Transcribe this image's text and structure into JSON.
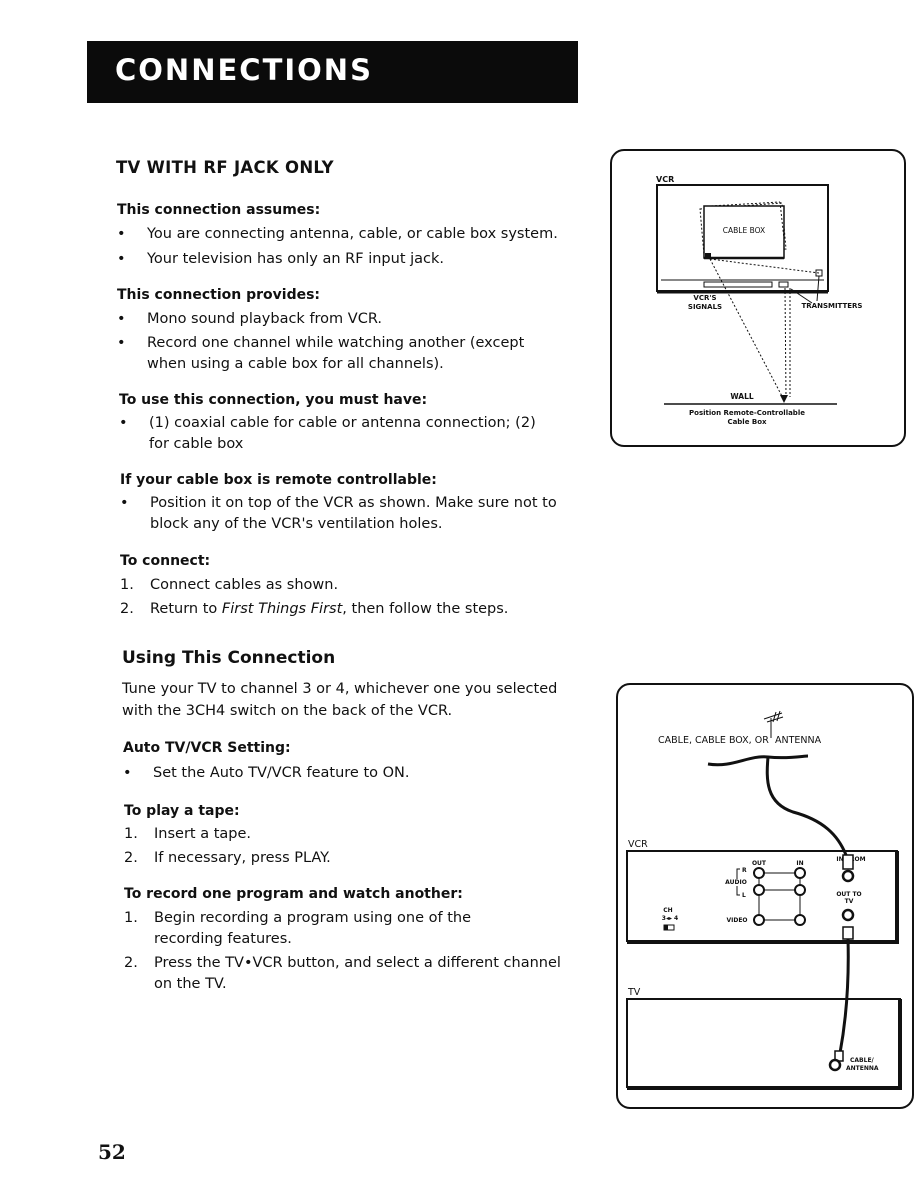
{
  "header": {
    "title": "CONNECTIONS"
  },
  "section": {
    "title": "TV WITH RF JACK ONLY",
    "assumes": {
      "heading": "This connection assumes:",
      "items": [
        "You are connecting antenna, cable, or cable box system.",
        "Your television has only an RF input jack."
      ]
    },
    "provides": {
      "heading": "This connection provides:",
      "items": [
        "Mono sound playback from VCR.",
        "Record one channel while watching another (except when using a cable box for all channels)."
      ]
    },
    "must_have": {
      "heading": "To use this connection, you must have:",
      "items": [
        "(1) coaxial cable for cable or antenna connection; (2) for cable box"
      ]
    },
    "remote": {
      "heading": "If your cable box is remote controllable:",
      "items": [
        "Position it on top of the VCR as shown. Make sure not to block any of the VCR's ventilation holes."
      ]
    },
    "connect": {
      "heading": "To connect:",
      "steps": [
        {
          "num": "1.",
          "text": "Connect cables as shown."
        },
        {
          "num": "2.",
          "pre": "Return to ",
          "italic": "First Things First",
          "post": ", then follow the steps."
        }
      ]
    }
  },
  "using": {
    "title": "Using This Connection",
    "intro": "Tune your TV to channel 3 or 4, whichever one you selected with the 3CH4 switch on the back of the VCR.",
    "auto": {
      "heading": "Auto TV/VCR Setting:",
      "items": [
        "Set the Auto TV/VCR feature to ON."
      ]
    },
    "play": {
      "heading": "To play a tape:",
      "steps": [
        {
          "num": "1.",
          "text": "Insert a tape."
        },
        {
          "num": "2.",
          "text": "If necessary, press PLAY."
        }
      ]
    },
    "record": {
      "heading": "To record one program and watch another:",
      "steps": [
        {
          "num": "1.",
          "text": "Begin recording a program using one of the recording features."
        },
        {
          "num": "2.",
          "text": "Press the TV•VCR button, and select a different channel on the TV."
        }
      ]
    }
  },
  "bullet": "•",
  "figure1": {
    "vcr_label": "VCR",
    "cable_box_label": "CABLE BOX",
    "signals_label_1": "VCR'S",
    "signals_label_2": "SIGNALS",
    "transmitters_label": "TRANSMITTERS",
    "wall_label": "WALL",
    "caption_1": "Position Remote-Controllable",
    "caption_2": "Cable Box"
  },
  "figure2": {
    "source_label_1": "CABLE, CABLE BOX, OR",
    "source_label_2": "ANTENNA",
    "vcr_label": "VCR",
    "out_label": "OUT",
    "in_label": "IN",
    "in_from_ant_label": "IN FROM",
    "audio_label": "AUDIO",
    "r_label": "R",
    "l_label": "L",
    "video_label": "VIDEO",
    "out_to_tv_label_1": "OUT TO",
    "out_to_tv_label_2": "TV",
    "ch_label": "CH",
    "ch_switch_label": "3◂▸ 4",
    "tv_label": "TV",
    "cable_antenna_label_1": "CABLE/",
    "cable_antenna_label_2": "ANTENNA"
  },
  "footer": {
    "page_number": "52"
  }
}
